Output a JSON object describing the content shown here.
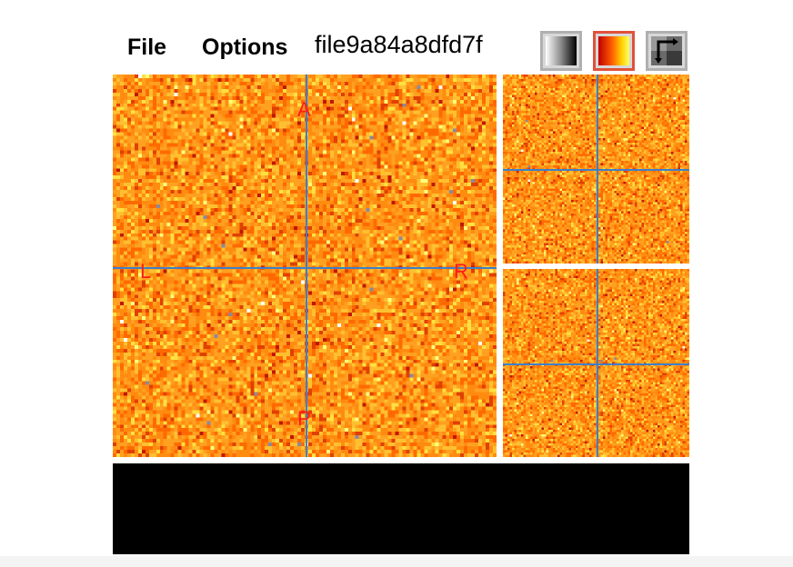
{
  "menu": {
    "file_label": "File",
    "options_label": "Options"
  },
  "filename": "file9a84a8dfd7f",
  "toolbar": {
    "buttons": [
      {
        "name": "grayscale-colormap",
        "icon": "grayscale-gradient-icon"
      },
      {
        "name": "hot-colormap",
        "icon": "hot-gradient-icon",
        "selected": true
      },
      {
        "name": "layout",
        "icon": "layout-swap-icon"
      }
    ]
  },
  "orientation": {
    "anterior": "A",
    "posterior": "P",
    "left": "L",
    "right": "R"
  },
  "colors": {
    "crosshair": "#3f7fc8",
    "orientation_label": "#ff1a1a",
    "hot_palette": [
      "#c01800",
      "#e04000",
      "#ff6a00",
      "#ff8c10",
      "#ffa020",
      "#ffc030",
      "#ffe040",
      "#ffff80"
    ]
  }
}
